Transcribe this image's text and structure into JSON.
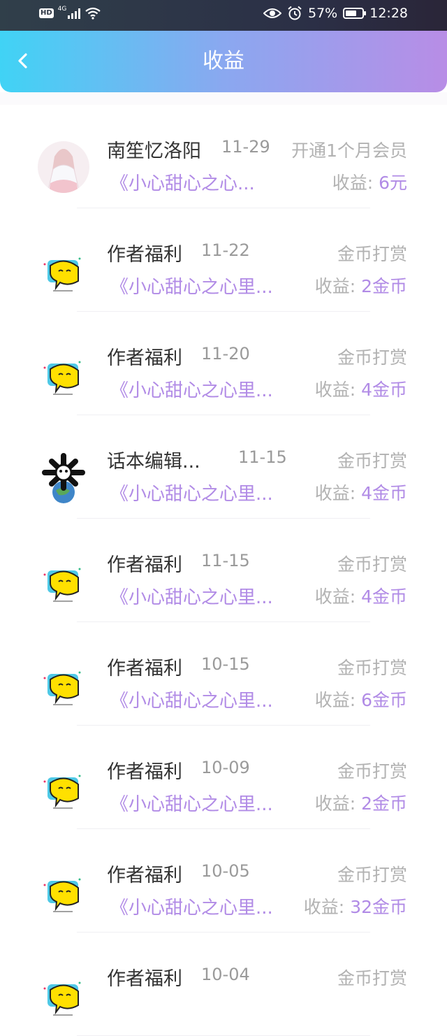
{
  "status_bar": {
    "hd": "HD",
    "network": "4G",
    "battery": "57%",
    "time": "12:28",
    "icons": [
      "signal-icon",
      "wifi-icon",
      "eye-icon",
      "alarm-icon",
      "battery-icon"
    ]
  },
  "header": {
    "title": "收益",
    "back_icon": "chevron-left-icon",
    "colors": {
      "gradient_start": "#40d3f5",
      "gradient_end": "#b88de6",
      "accent": "#b18be6"
    }
  },
  "income_label": "收益:",
  "records": [
    {
      "name": "南笙忆洛阳",
      "date": "11-29",
      "type": "开通1个月会员",
      "book": "《小心甜心之心...",
      "amount": "6元",
      "avatar": "girl"
    },
    {
      "name": "作者福利",
      "date": "11-22",
      "type": "金币打赏",
      "book": "《小心甜心之心里...",
      "amount": "2金币",
      "avatar": "bubble"
    },
    {
      "name": "作者福利",
      "date": "11-20",
      "type": "金币打赏",
      "book": "《小心甜心之心里...",
      "amount": "4金币",
      "avatar": "bubble"
    },
    {
      "name": "话本编辑...",
      "date": "11-15",
      "type": "金币打赏",
      "book": "《小心甜心之心里...",
      "amount": "4金币",
      "avatar": "editor"
    },
    {
      "name": "作者福利",
      "date": "11-15",
      "type": "金币打赏",
      "book": "《小心甜心之心里...",
      "amount": "4金币",
      "avatar": "bubble"
    },
    {
      "name": "作者福利",
      "date": "10-15",
      "type": "金币打赏",
      "book": "《小心甜心之心里...",
      "amount": "6金币",
      "avatar": "bubble"
    },
    {
      "name": "作者福利",
      "date": "10-09",
      "type": "金币打赏",
      "book": "《小心甜心之心里...",
      "amount": "2金币",
      "avatar": "bubble"
    },
    {
      "name": "作者福利",
      "date": "10-05",
      "type": "金币打赏",
      "book": "《小心甜心之心里...",
      "amount": "32金币",
      "avatar": "bubble"
    },
    {
      "name": "作者福利",
      "date": "10-04",
      "type": "金币打赏",
      "book": "",
      "amount": "",
      "avatar": "bubble"
    }
  ]
}
